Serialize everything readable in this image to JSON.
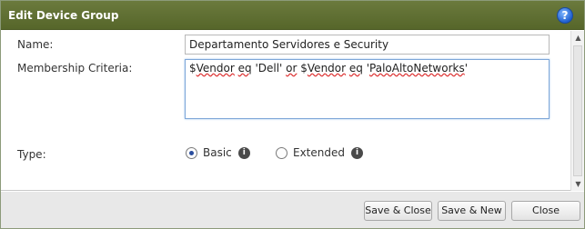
{
  "dialog": {
    "title": "Edit Device Group",
    "help_label": "?"
  },
  "form": {
    "name_label": "Name:",
    "name_value": "Departamento Servidores e Security",
    "criteria_label": "Membership Criteria:",
    "criteria_parts": [
      "$",
      "Vendor",
      " ",
      "eq",
      " 'Dell' ",
      "or",
      " $",
      "Vendor",
      " ",
      "eq",
      " '",
      "PaloAltoNetworks",
      "'"
    ],
    "type_label": "Type:",
    "type_options": [
      {
        "label": "Basic",
        "selected": true
      },
      {
        "label": "Extended",
        "selected": false
      }
    ],
    "info_icon_glyph": "i"
  },
  "scrollbar": {
    "up_glyph": "▲",
    "down_glyph": "▼"
  },
  "footer": {
    "save_close_label": "Save & Close",
    "save_new_label": "Save & New",
    "close_label": "Close"
  },
  "colors": {
    "titlebar": "#5f6f33",
    "selected_radio": "#2a4d9e"
  }
}
